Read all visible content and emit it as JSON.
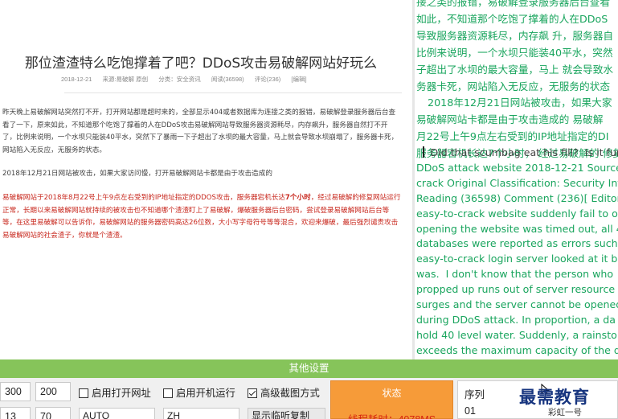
{
  "article": {
    "title": "那位渣渣特么吃饱撑着了吧？DDoS攻击易破解网站好玩么",
    "meta": {
      "date": "2018-12-21",
      "source": "来源:易破解 原创",
      "category": "分类：安全资讯",
      "reads": "阅读(36598)",
      "comments": "评论(236)",
      "edit": "[编辑]"
    },
    "p1": "昨天晚上易破解网站突然打不开，打开网站都是超时来的，全部显示404或者数据库为连接之类的报错，易破解登录服务器后台查看了一下，原来如此，不知道那个吃饱了撑着的人在DDoS攻击易破解网站导致服务器资源耗尽，内存飙升，服务器自然打不开了，比例来说明，一个水坝只能装40平水，突然下了暴雨一下子超出了水坝的最大容量，马上就会导致水坝崩塌了，服务器卡死，网站陷入无反应，无服务的状态。",
    "p2": "2018年12月21日网站被攻击，如果大家访问慢，打开易破解网站卡都是由于攻击造成的",
    "p3_before": "易破解网站于2018年8月22号上午9点左右受到的IP地址指定的DDOS攻击，服务器宕机长达",
    "p3_bold": "7个小时",
    "p3_after": "，经过易破解的修复网站运行正常，长期以来易破解网站就持续的被攻击也不知道哪个渣渣盯上了易破解，爆破服务器后台密码，尝试登录易破解网站后台等等，在这里易破解可以告诉你，易破解网站的服务器密码高达26位数，大小写字母符号等等混合，欢迎来爆破，最后强烈谴责攻击易破解网站的社会渣子，你就是个渣渣。"
  },
  "translation": {
    "zh_lines": [
      "接之类的报错，易破解登录服务器后台查看",
      "如此，不知道那个吃饱了撑着的人在DDoS",
      "导致服务器资源耗尽，内存飙 升，服务器自",
      "比例来说明，一个水坝只能装40平水，突然",
      "子超出了水坝的最大容量，马上 就会导致水",
      "务器卡死，网站陷入无反应，无服务的状态",
      "2018年12月21日网站被攻击，如果大家",
      "易破解网站卡都是由于攻击造成的 易破解",
      "月22号上午9点左右受到的IP地址指定的DI",
      "服务器宕机长达7个小时， 经过易破解的 修复网"
    ],
    "en_first": "Did that scumbag eat his fill?  Is it fun",
    "en_lines": [
      "DDoS attack website 2018-12-21 Source",
      "crack Original Classification: Security Inf",
      "Reading (36598) Comment (236)[ Editor",
      "easy-to-crack website suddenly fail to o",
      "opening the website was timed out, all 4",
      "databases were reported as errors such",
      "easy-to-crack login server looked at it b",
      "was.  I don't know that the person who",
      "propped up runs out of server resource",
      "surges and the server cannot be opened",
      "during DDoS attack. In proportion, a da",
      "hold 40 level water. Suddenly, a rainstor",
      "exceeds the maximum capacity of the d"
    ]
  },
  "settings_bar": {
    "title": "其他设置"
  },
  "controls": {
    "width_value": "300",
    "height_value": "200",
    "val3": "13",
    "val4": "70",
    "open_site_label": "启用打开网址",
    "open_site_checked": false,
    "boot_run_label": "启用开机运行",
    "boot_run_checked": false,
    "advanced_capture_label": "高级截图方式",
    "advanced_capture_checked": true,
    "select1": "AUTO",
    "select2": "ZH",
    "select3": "显示临听复制"
  },
  "status": {
    "label": "状态",
    "timing": "线程耗时：4078MS"
  },
  "seq": {
    "header": "序列",
    "cell": "01"
  },
  "watermark": {
    "big": "最需教育",
    "small": "彩虹一号"
  },
  "colors": {
    "green_text": "#1aa55e",
    "red_text": "#c8281e",
    "settings_bar": "#86c45a",
    "status_panel": "#f69b39",
    "watermark": "#17357f"
  }
}
